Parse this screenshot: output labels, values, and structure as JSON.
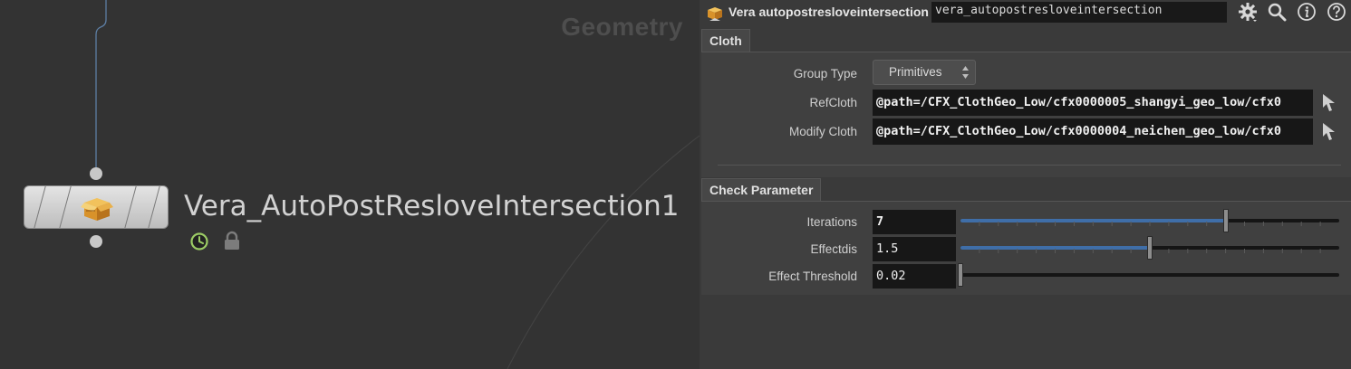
{
  "network": {
    "context_label": "Geometry",
    "node": {
      "name": "Vera_AutoPostResloveIntersection1",
      "icon": "box-icon",
      "flags": [
        "clock-icon",
        "lock-icon"
      ]
    }
  },
  "params": {
    "header": {
      "node_type": "Vera autopostresloveintersection",
      "node_name": "vera_autopostresloveintersection",
      "icons": [
        "gear-icon",
        "search-icon",
        "info-icon",
        "help-icon"
      ]
    },
    "cloth_tab": {
      "label": "Cloth",
      "group_type": {
        "label": "Group Type",
        "value": "Primitives"
      },
      "ref_cloth": {
        "label": "RefCloth",
        "value": "@path=/CFX_ClothGeo_Low/cfx0000005_shangyi_geo_low/cfx0"
      },
      "modify_cloth": {
        "label": "Modify Cloth",
        "value": "@path=/CFX_ClothGeo_Low/cfx0000004_neichen_geo_low/cfx0"
      }
    },
    "check_tab": {
      "label": "Check Parameter",
      "iterations": {
        "label": "Iterations",
        "value": "7",
        "slider_fraction": 0.7
      },
      "effectdis": {
        "label": "Effectdis",
        "value": "1.5",
        "slider_fraction": 0.5
      },
      "effect_threshold": {
        "label": "Effect Threshold",
        "value": "0.02",
        "slider_fraction": 0.0
      }
    }
  },
  "colors": {
    "slider_fill": "#3f6ea8",
    "wire": "#5d7ea3",
    "flag_clock": "#9ccc65"
  }
}
